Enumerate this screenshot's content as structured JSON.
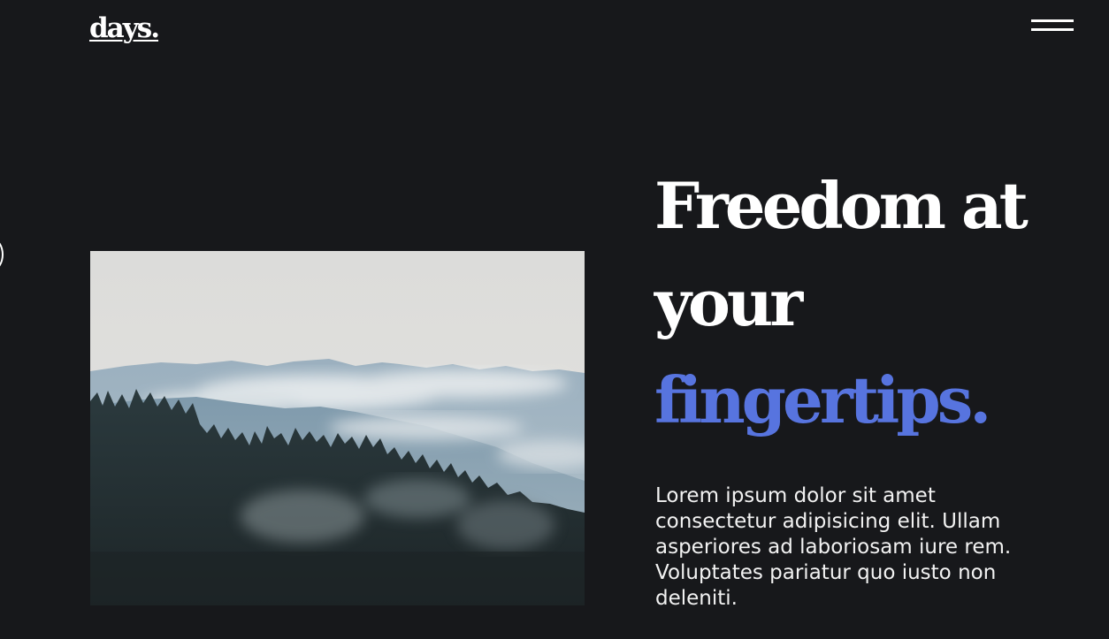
{
  "header": {
    "logo_text": "days.",
    "menu_icon": "hamburger-menu-icon"
  },
  "hero": {
    "headline_line1": "Freedom at",
    "headline_line2": "your",
    "headline_line3": "fingertips.",
    "description": "Lorem ipsum dolor sit amet consectetur adipisicing elit. Ullam asperiores ad laboriosam iure rem. Voluptates pariatur quo iusto non deleniti.",
    "image_subject": "misty mountain forest"
  },
  "colors": {
    "background": "#17181b",
    "text": "#ffffff",
    "accent": "#5774df"
  }
}
